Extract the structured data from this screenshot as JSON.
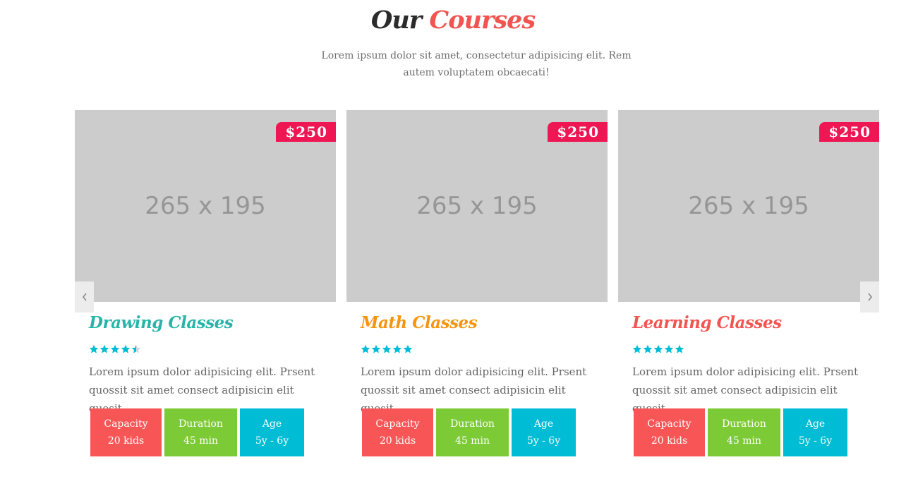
{
  "section": {
    "title_part1": "Our",
    "title_part2": "Courses",
    "subtitle": "Lorem ipsum dolor sit amet, consectetur adipisicing elit. Rem autem voluptatem obcaecati!"
  },
  "colors": {
    "title_dark": "#2b2b2b",
    "title_accent": "#f25450",
    "price_badge": "#ee1653",
    "capacity_tag": "#f85656",
    "duration_tag": "#7cca35",
    "age_tag": "#00bcd4",
    "star": "#00bcd4"
  },
  "carousel": {
    "prev_icon": "chevron-left-icon",
    "next_icon": "chevron-right-icon"
  },
  "courses": [
    {
      "image_label": "265 x 195",
      "price": "$250",
      "title": "Drawing Classes",
      "title_color": "#26b5a8",
      "rating": 4.5,
      "description": "Lorem ipsum dolor adipisicing elit. Prsent quossit sit amet consect adipisicin elit quosit",
      "capacity_label": "Capacity",
      "capacity_value": "20 kids",
      "duration_label": "Duration",
      "duration_value": "45 min",
      "age_label": "Age",
      "age_value": "5y - 6y"
    },
    {
      "image_label": "265 x 195",
      "price": "$250",
      "title": "Math Classes",
      "title_color": "#f7940d",
      "rating": 5,
      "description": "Lorem ipsum dolor adipisicing elit. Prsent quossit sit amet consect adipisicin elit quosit",
      "capacity_label": "Capacity",
      "capacity_value": "20 kids",
      "duration_label": "Duration",
      "duration_value": "45 min",
      "age_label": "Age",
      "age_value": "5y - 6y"
    },
    {
      "image_label": "265 x 195",
      "price": "$250",
      "title": "Learning Classes",
      "title_color": "#f25450",
      "rating": 5,
      "description": "Lorem ipsum dolor adipisicing elit. Prsent quossit sit amet consect adipisicin elit quosit",
      "capacity_label": "Capacity",
      "capacity_value": "20 kids",
      "duration_label": "Duration",
      "duration_value": "45 min",
      "age_label": "Age",
      "age_value": "5y - 6y"
    }
  ]
}
